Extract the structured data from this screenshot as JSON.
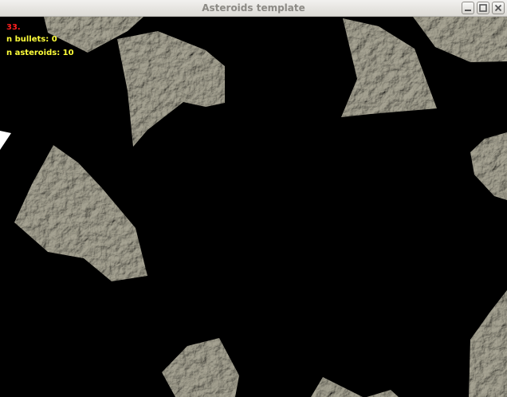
{
  "window": {
    "title": "Asteroids template",
    "controls": {
      "minimize_icon": "minimize-icon",
      "maximize_icon": "maximize-icon",
      "close_icon": "close-icon"
    }
  },
  "hud": {
    "fps": "33.",
    "bullets": "n bullets: 0",
    "asteroids": "n asteroids: 10",
    "fps_color": "#ff1f1f",
    "text_color": "#ffff3a"
  },
  "scene": {
    "background": "#000000",
    "asteroid_texture": "rocky-stone",
    "asteroid_count_visible": 10,
    "ship": "white-triangle-ship"
  }
}
